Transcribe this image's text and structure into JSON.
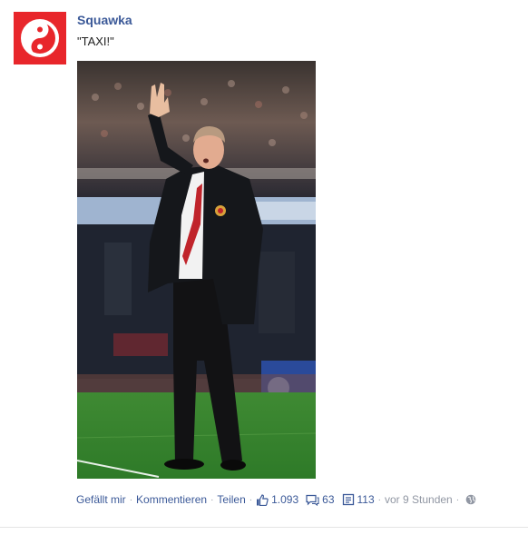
{
  "post": {
    "page_name": "Squawka",
    "text": "\"TAXI!\"",
    "brand_color": "#e8262b",
    "link_color": "#3b5998",
    "photo_alt_icon": "football-manager-photo"
  },
  "actions": {
    "like_label": "Gefällt mir",
    "comment_label": "Kommentieren",
    "share_label": "Teilen",
    "likes_count": "1.093",
    "comments_count": "63",
    "shares_count": "113",
    "timestamp": "vor 9 Stunden",
    "separator": "·"
  }
}
